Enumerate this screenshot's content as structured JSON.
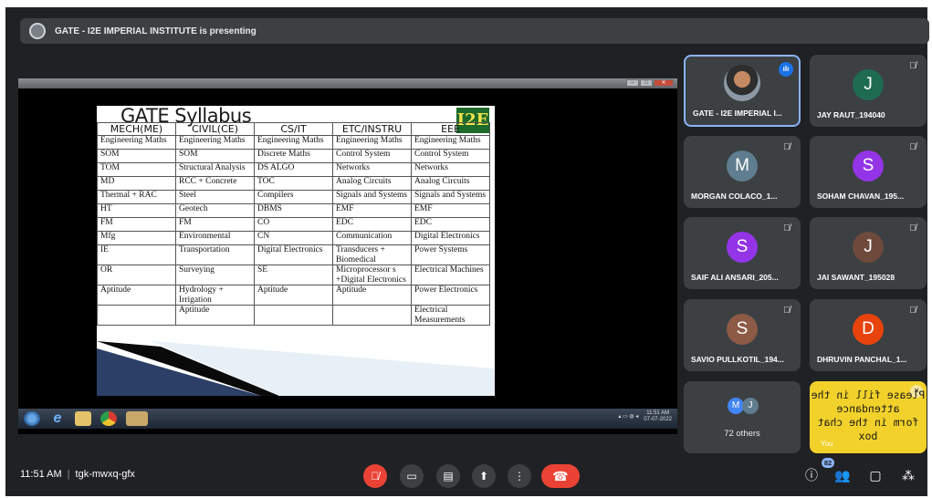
{
  "banner": {
    "text": "GATE - I2E IMPERIAL INSTITUTE is presenting"
  },
  "slide": {
    "title": "GATE Syllabus",
    "logo": "I2E",
    "columns": [
      "MECH(ME)",
      "CIVIL(CE)",
      "CS/IT",
      "ETC/INSTRU",
      "EEE"
    ],
    "rows": [
      [
        "Engineering Maths",
        "Engineering Maths",
        "Engineering Maths",
        "Engineering Maths",
        "Engineering Maths"
      ],
      [
        "SOM",
        "SOM",
        "Discrete Maths",
        "Control System",
        "Control System"
      ],
      [
        "TOM",
        "Structural Analysis",
        "DS ALGO",
        "Networks",
        "Networks"
      ],
      [
        "MD",
        "RCC + Concrete",
        "TOC",
        "Analog Circuits",
        "Analog Circuits"
      ],
      [
        "Thermal + RAC",
        "Steel",
        "Compilers",
        "Signals and Systems",
        "Signals and Systems"
      ],
      [
        "HT",
        "Geotech",
        "DBMS",
        "EMF",
        "EMF"
      ],
      [
        "FM",
        "FM",
        "CO",
        "EDC",
        "EDC"
      ],
      [
        "Mfg",
        "Environmental",
        "CN",
        "Communication",
        "Digital Electronics"
      ],
      [
        "IE",
        "Transportation",
        "Digital Electronics",
        "Transducers + Biomedical",
        "Power Systems"
      ],
      [
        "OR",
        "Surveying",
        "SE",
        "Microprocessor s +Digital Electronics",
        "Electrical Machines"
      ],
      [
        "Aptitude",
        "Hydrology + Irrigation",
        "Aptitude",
        "Aptitude",
        "Power Electronics"
      ],
      [
        "",
        "Aptitude",
        "",
        "",
        "Electrical Measurements"
      ]
    ]
  },
  "taskbar": {
    "time": "11:51 AM",
    "date": "07-07-2022"
  },
  "participants": [
    {
      "name": "GATE - I2E IMPERIAL I...",
      "initial": "",
      "color": "",
      "speaking": true
    },
    {
      "name": "JAY RAUT_194040",
      "initial": "J",
      "color": "#1e6b52"
    },
    {
      "name": "MORGAN COLACO_1...",
      "initial": "M",
      "color": "#5f7d8e"
    },
    {
      "name": "SOHAM CHAVAN_195...",
      "initial": "S",
      "color": "#9334e6"
    },
    {
      "name": "SAIF ALI ANSARI_205...",
      "initial": "S",
      "color": "#9334e6"
    },
    {
      "name": "JAI SAWANT_195028",
      "initial": "J",
      "color": "#6d4a3c"
    },
    {
      "name": "SAVIO PULLKOTIL_194...",
      "initial": "S",
      "color": "#8d5a46"
    },
    {
      "name": "DHRUVIN PANCHAL_1...",
      "initial": "D",
      "color": "#e8430d"
    }
  ],
  "others": {
    "label": "72 others",
    "avatar1": "M",
    "avatar2": "J"
  },
  "self_tile": {
    "line1": "Please fill in the",
    "line2": "attendance",
    "line3": "form in the chat",
    "line4": "box",
    "you": "You"
  },
  "bottom": {
    "time": "11:51 AM",
    "separator": "|",
    "meeting_code": "tgk-mwxq-gfx",
    "participant_count": "82"
  }
}
